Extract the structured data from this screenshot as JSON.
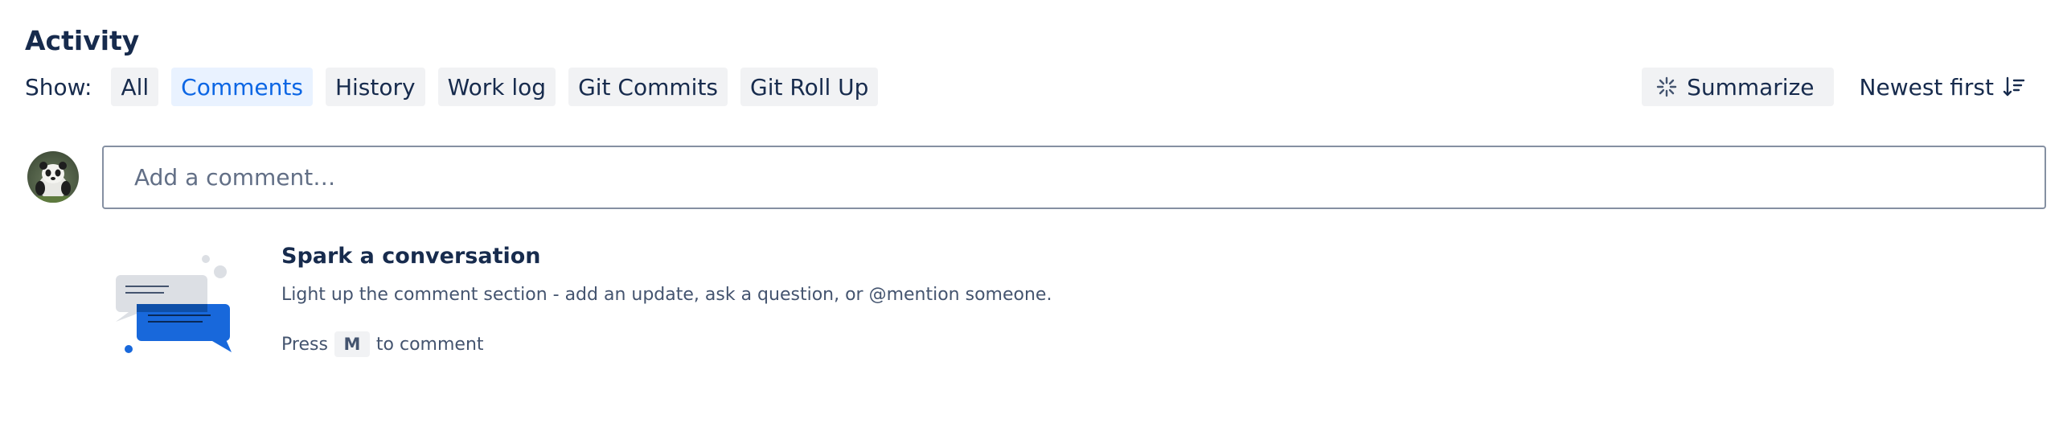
{
  "activity": {
    "heading": "Activity",
    "show_label": "Show:",
    "filters": [
      {
        "label": "All",
        "active": false
      },
      {
        "label": "Comments",
        "active": true
      },
      {
        "label": "History",
        "active": false
      },
      {
        "label": "Work log",
        "active": false
      },
      {
        "label": "Git Commits",
        "active": false
      },
      {
        "label": "Git Roll Up",
        "active": false
      }
    ],
    "summarize_label": "Summarize",
    "sort_label": "Newest first"
  },
  "comment": {
    "placeholder": "Add a comment…"
  },
  "empty_state": {
    "title": "Spark a conversation",
    "description": "Light up the comment section - add an update, ask a question, or @mention someone.",
    "press_prefix": "Press",
    "shortcut_key": "M",
    "press_suffix": "to comment"
  },
  "colors": {
    "text": "#172b4d",
    "accent": "#0c66e4",
    "active_chip_bg": "#e9f2ff",
    "chip_bg": "#f1f2f4"
  },
  "icons": {
    "summarize": "ai-sparkle-icon",
    "sort": "sort-descending-icon",
    "avatar": "user-avatar-panda",
    "illustration": "chat-bubbles-illustration"
  }
}
